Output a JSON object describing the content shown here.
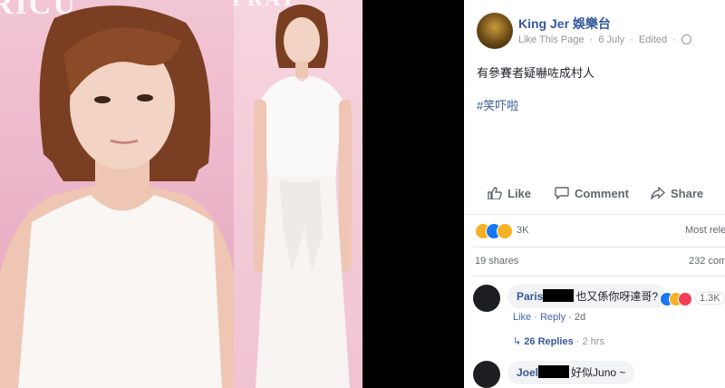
{
  "photo": {
    "wall_text_left": "RICU",
    "wall_text_right": "PRAT"
  },
  "post": {
    "page_name": "King Jer 娛樂台",
    "meta": {
      "like_page": "Like This Page",
      "date": "6 July",
      "edited": "Edited"
    },
    "text": "有參賽者疑嚇咗成村人",
    "hashtag": "#笑吓啦",
    "actions": {
      "like": "Like",
      "comment": "Comment",
      "share": "Share"
    },
    "reaction_count": "3K",
    "most_relevant": "Most rele",
    "shares": "19 shares",
    "comments_count": "232 com"
  },
  "comments": [
    {
      "author": "Paris",
      "text": "也又係你呀達哥?",
      "reaction_count": "1.3K",
      "like": "Like",
      "reply": "Reply",
      "time": "2d",
      "replies_label": "26 Replies",
      "replies_time": "2 hrs"
    },
    {
      "author": "Joel",
      "text": "好似Juno ~"
    }
  ],
  "colors": {
    "link": "#365899",
    "meta": "#90949c",
    "reaction_like": "#1877f2",
    "reaction_haha": "#f7b125",
    "reaction_love": "#f33e58"
  }
}
